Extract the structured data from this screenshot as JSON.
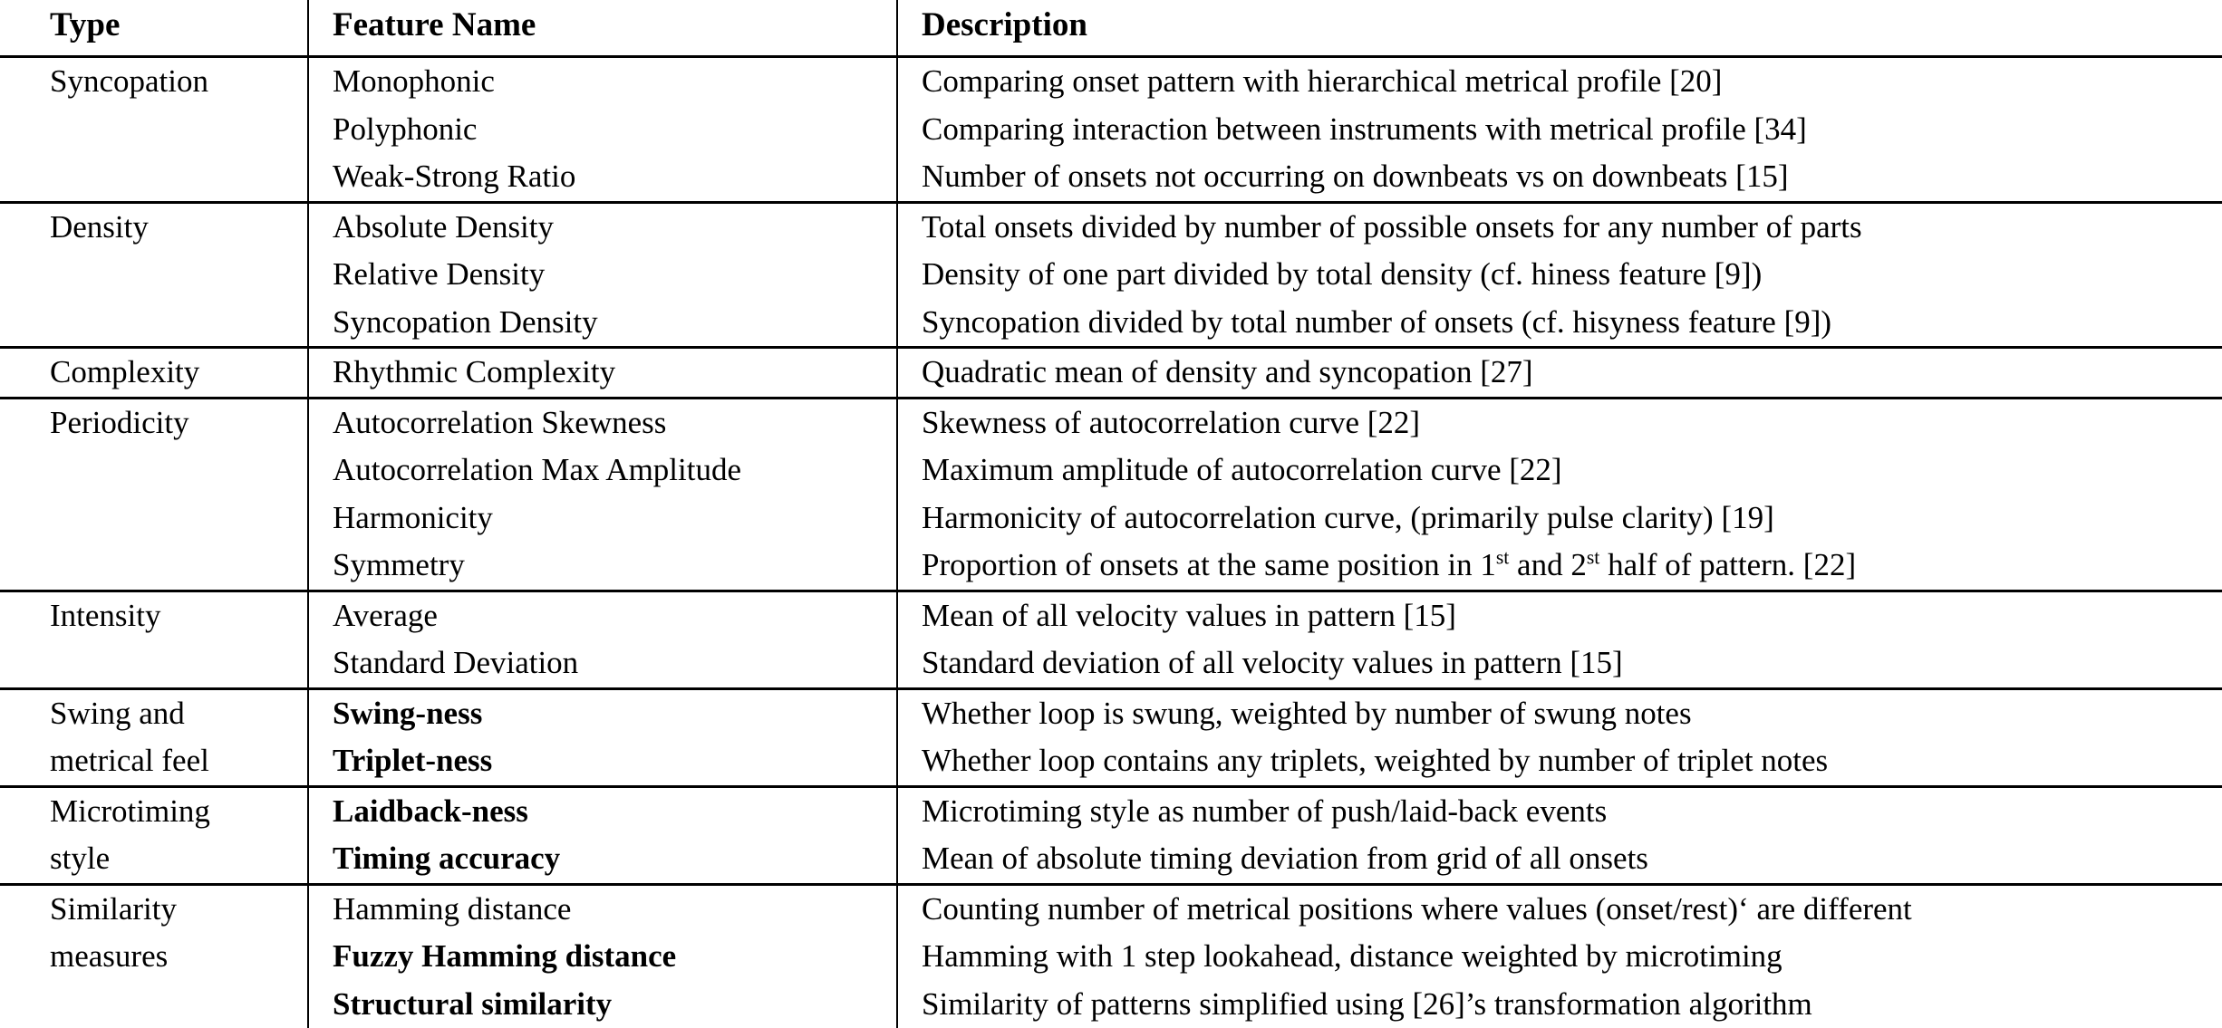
{
  "table": {
    "columns": [
      {
        "key": "type",
        "label": "Type"
      },
      {
        "key": "feature",
        "label": "Feature Name"
      },
      {
        "key": "description",
        "label": "Description"
      }
    ],
    "groups": [
      {
        "type_lines": [
          "Syncopation"
        ],
        "rows": [
          {
            "feature": "Monophonic",
            "bold": false,
            "description": "Comparing onset pattern with hierarchical metrical profile [20]"
          },
          {
            "feature": "Polyphonic",
            "bold": false,
            "description": "Comparing interaction between instruments with metrical profile [34]"
          },
          {
            "feature": "Weak-Strong Ratio",
            "bold": false,
            "description": "Number of onsets not occurring on downbeats vs on downbeats [15]"
          }
        ]
      },
      {
        "type_lines": [
          "Density"
        ],
        "rows": [
          {
            "feature": "Absolute Density",
            "bold": false,
            "description": "Total onsets divided by number of possible onsets for any number of parts"
          },
          {
            "feature": "Relative Density",
            "bold": false,
            "description": "Density of one part divided by total density (cf. hiness feature [9])"
          },
          {
            "feature": "Syncopation Density",
            "bold": false,
            "description": "Syncopation divided by total number of onsets (cf. hisyness feature [9])"
          }
        ]
      },
      {
        "type_lines": [
          "Complexity"
        ],
        "rows": [
          {
            "feature": "Rhythmic Complexity",
            "bold": false,
            "description": "Quadratic mean of density and syncopation [27]"
          }
        ]
      },
      {
        "type_lines": [
          "Periodicity"
        ],
        "rows": [
          {
            "feature": "Autocorrelation Skewness",
            "bold": false,
            "description": "Skewness of autocorrelation curve [22]"
          },
          {
            "feature": "Autocorrelation Max Amplitude",
            "bold": false,
            "description": "Maximum amplitude of autocorrelation curve [22]"
          },
          {
            "feature": "Harmonicity",
            "bold": false,
            "description": "Harmonicity of autocorrelation curve, (primarily pulse clarity) [19]"
          },
          {
            "feature": "Symmetry",
            "bold": false,
            "description_html": "Proportion of onsets at the same position in 1<sup>st</sup> and 2<sup>st</sup> half of pattern. [22]"
          }
        ]
      },
      {
        "type_lines": [
          "Intensity"
        ],
        "rows": [
          {
            "feature": "Average",
            "bold": false,
            "description": "Mean of all velocity values in pattern [15]"
          },
          {
            "feature": "Standard Deviation",
            "bold": false,
            "description": "Standard deviation of all velocity values in pattern [15]"
          }
        ]
      },
      {
        "type_lines": [
          "Swing and",
          "metrical feel"
        ],
        "rows": [
          {
            "feature": "Swing-ness",
            "bold": true,
            "description": "Whether loop is swung, weighted by number of swung notes"
          },
          {
            "feature": "Triplet-ness",
            "bold": true,
            "description": "Whether loop contains any triplets, weighted by number of triplet notes"
          }
        ]
      },
      {
        "type_lines": [
          "Microtiming",
          "style"
        ],
        "rows": [
          {
            "feature": "Laidback-ness",
            "bold": true,
            "description": "Microtiming style as number of push/laid-back events"
          },
          {
            "feature": "Timing accuracy",
            "bold": true,
            "description": "Mean of absolute timing deviation from grid of all onsets"
          }
        ]
      },
      {
        "type_lines": [
          "Similarity",
          "measures"
        ],
        "rows": [
          {
            "feature": "Hamming distance",
            "bold": false,
            "description": "Counting number of metrical positions where values (onset/rest)‘ are different"
          },
          {
            "feature": "Fuzzy Hamming distance",
            "bold": true,
            "description": "Hamming with 1 step lookahead, distance weighted by microtiming"
          },
          {
            "feature": "Structural similarity",
            "bold": true,
            "description": "Similarity of patterns simplified using [26]’s transformation algorithm"
          }
        ]
      }
    ]
  }
}
